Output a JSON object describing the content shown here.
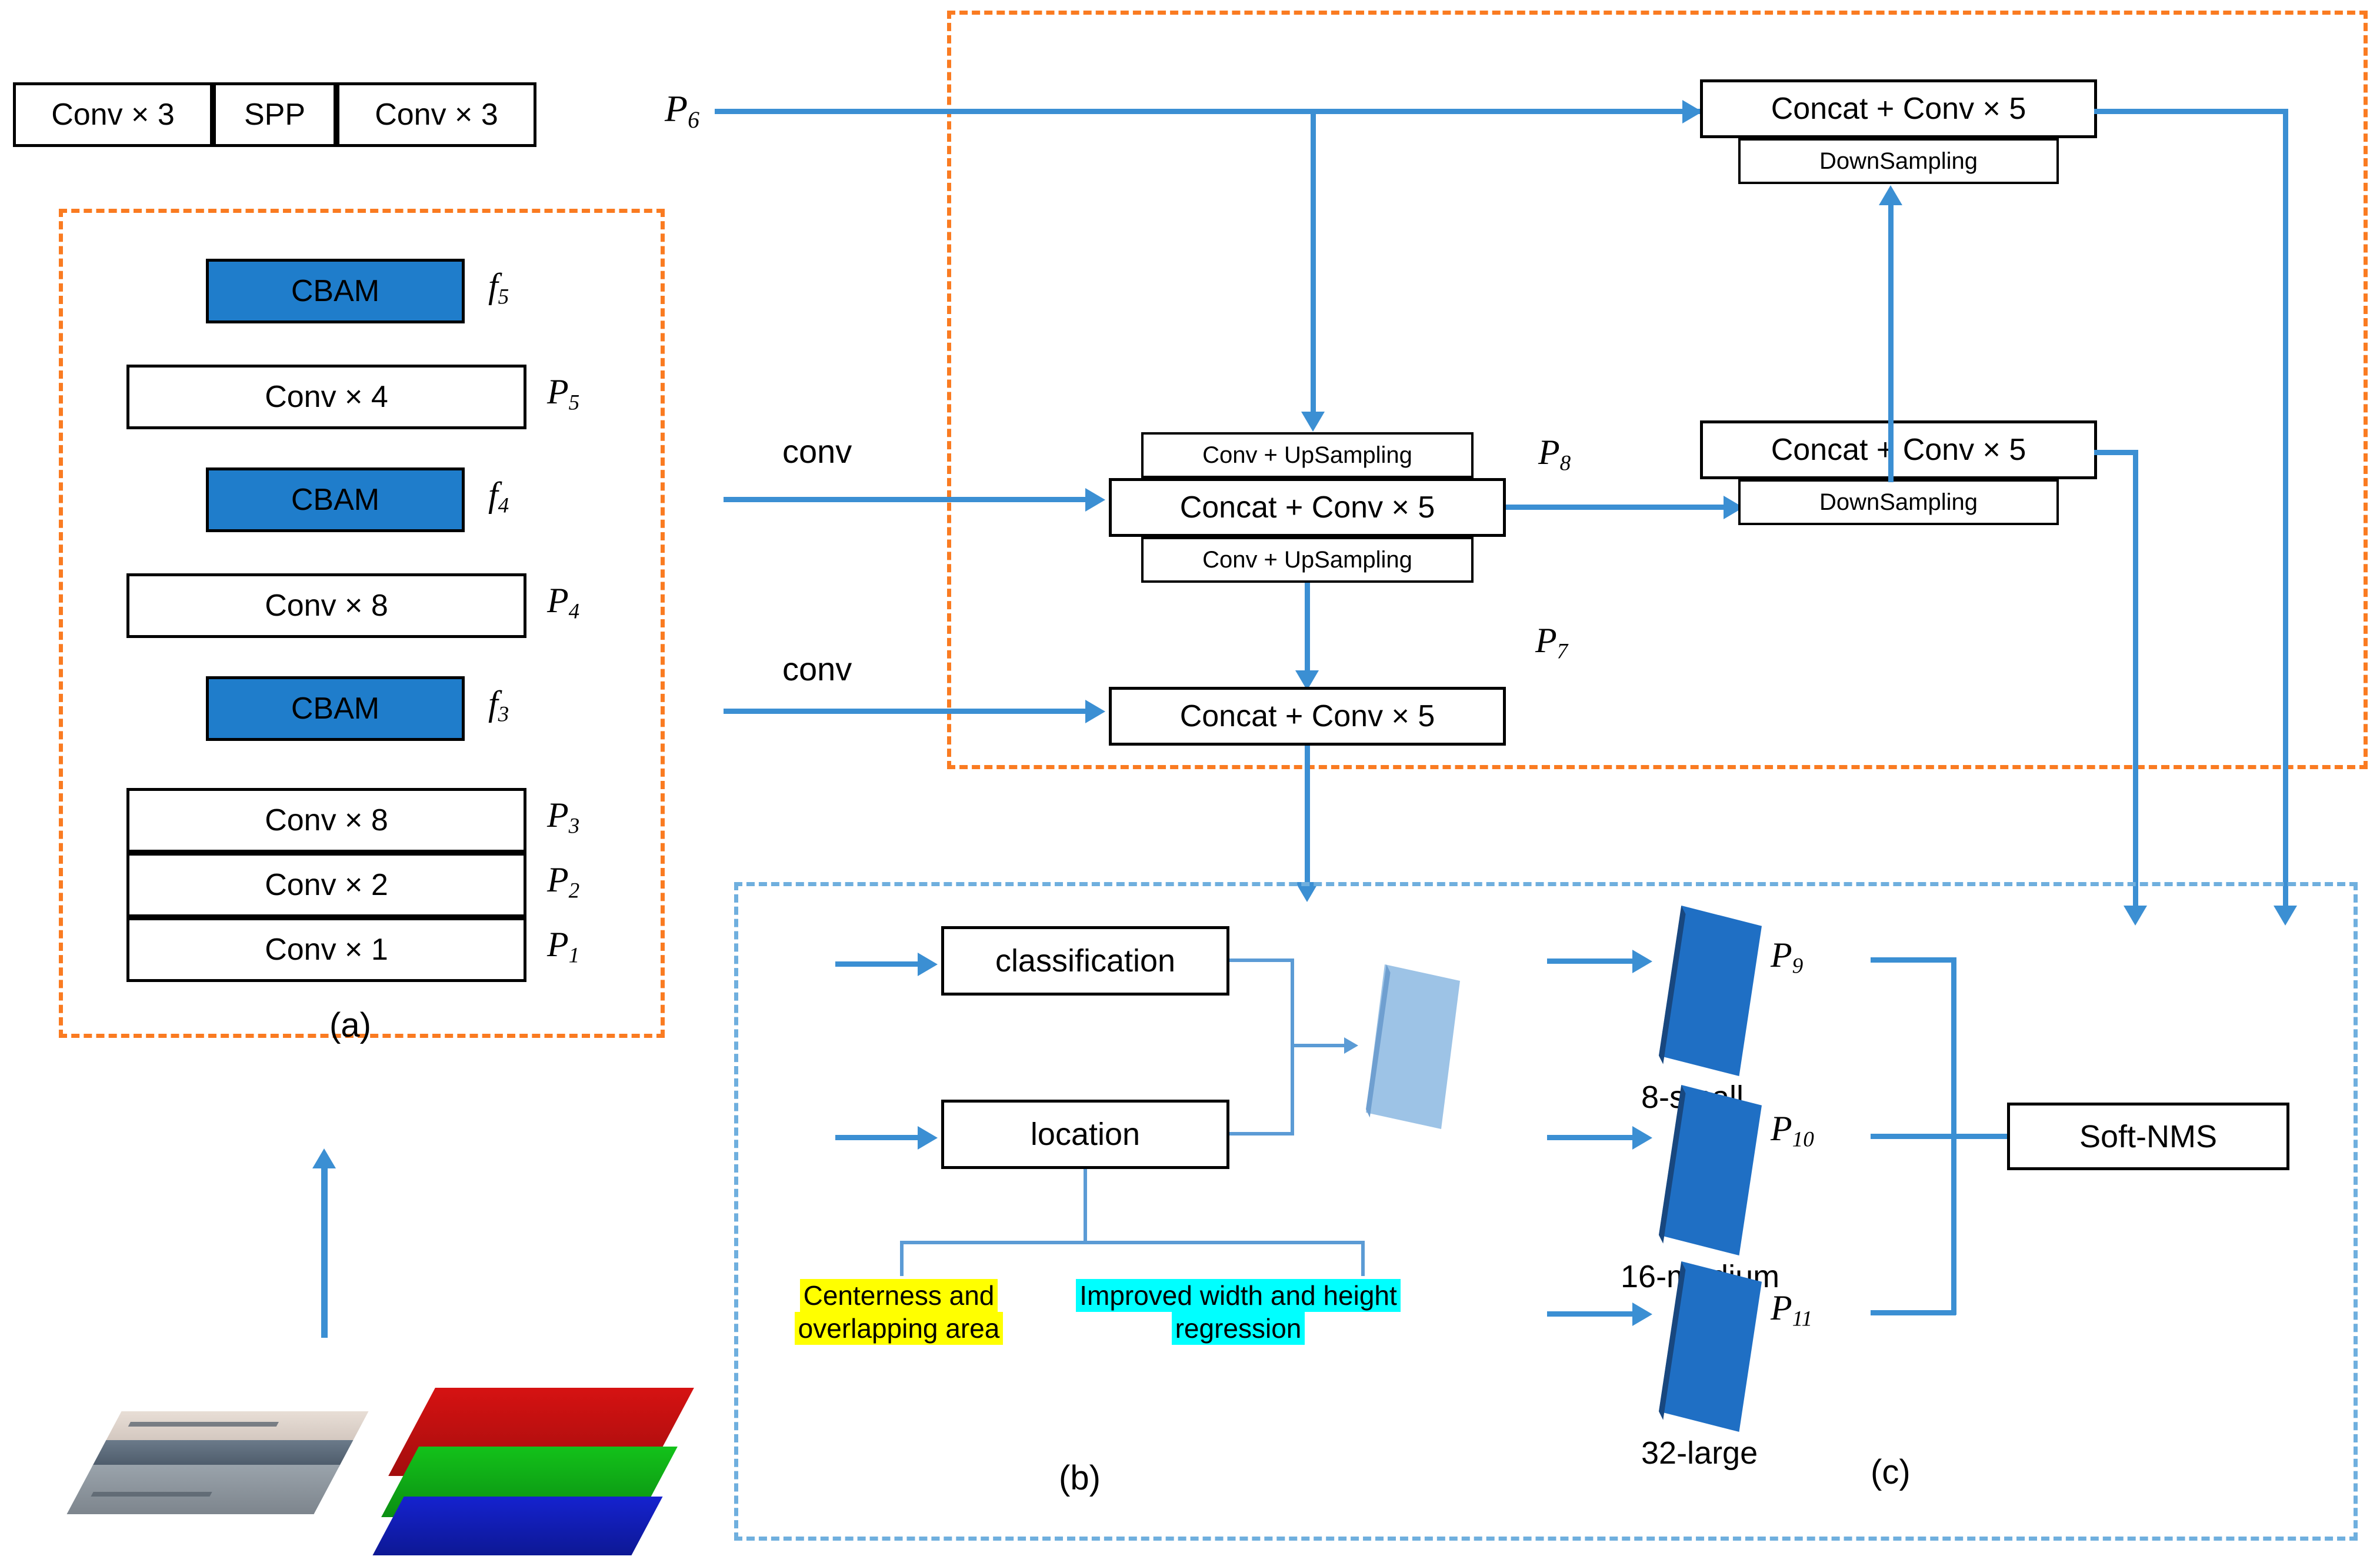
{
  "figure": {
    "panels": [
      {
        "id": "a",
        "caption": "(a)"
      },
      {
        "id": "b",
        "caption": "(b)"
      },
      {
        "id": "c",
        "caption": "(c)"
      }
    ]
  },
  "backbone": {
    "head_row": {
      "cells": [
        "Conv × 3",
        "SPP",
        "Conv × 3"
      ],
      "label": "P",
      "label_sub": "6"
    },
    "layers": [
      {
        "text": "CBAM",
        "label": "f",
        "sub": "5",
        "kind": "cbam"
      },
      {
        "text": "Conv × 4",
        "label": "P",
        "sub": "5",
        "kind": "conv"
      },
      {
        "text": "CBAM",
        "label": "f",
        "sub": "4",
        "kind": "cbam"
      },
      {
        "text": "Conv × 8",
        "label": "P",
        "sub": "4",
        "kind": "conv"
      },
      {
        "text": "CBAM",
        "label": "f",
        "sub": "3",
        "kind": "cbam"
      },
      {
        "text": "Conv × 8",
        "label": "P",
        "sub": "3",
        "kind": "conv"
      },
      {
        "text": "Conv × 2",
        "label": "P",
        "sub": "2",
        "kind": "conv"
      },
      {
        "text": "Conv × 1",
        "label": "P",
        "sub": "1",
        "kind": "conv"
      }
    ]
  },
  "input": {
    "gray_image_alt": "grayscale-landscape-photo",
    "channels": [
      "red-channel",
      "green-channel",
      "blue-channel"
    ]
  },
  "neck": {
    "conv_labels": [
      "conv",
      "conv"
    ],
    "blocks": {
      "p8": {
        "up_top": "Conv + UpSampling",
        "center": "Concat + Conv × 5",
        "up_bottom": "Conv + UpSampling",
        "label": "P",
        "label_sub": "8"
      },
      "p7": {
        "center": "Concat + Conv × 5",
        "label": "P",
        "label_sub": "7"
      },
      "right_top": {
        "center": "Concat + Conv × 5",
        "down": "DownSampling"
      },
      "right_mid": {
        "center": "Concat + Conv × 5",
        "down": "DownSampling"
      }
    }
  },
  "head_b": {
    "classification": "classification",
    "location": "location",
    "highlights": [
      {
        "text": "Centerness and overlapping area",
        "color": "#ffff00",
        "name": "centerness"
      },
      {
        "text": "Improved width and height regression",
        "color": "#00ffff",
        "name": "wh-regression"
      }
    ]
  },
  "head_c": {
    "scales": [
      {
        "label": "P",
        "sub": "9",
        "caption": "8-small"
      },
      {
        "label": "P",
        "sub": "10",
        "caption": "16-medium"
      },
      {
        "label": "P",
        "sub": "11",
        "caption": "32-large"
      }
    ],
    "nms": "Soft-NMS"
  },
  "colors": {
    "cbam_blue": "#1f7dcb",
    "arrow_blue": "#3b8fd3",
    "panel_orange": "#fa7b21",
    "panel_lightblue": "#6fafde",
    "slab_blue": "#1f6fc4",
    "highlight_yellow": "#ffff00",
    "highlight_cyan": "#00ffff"
  }
}
